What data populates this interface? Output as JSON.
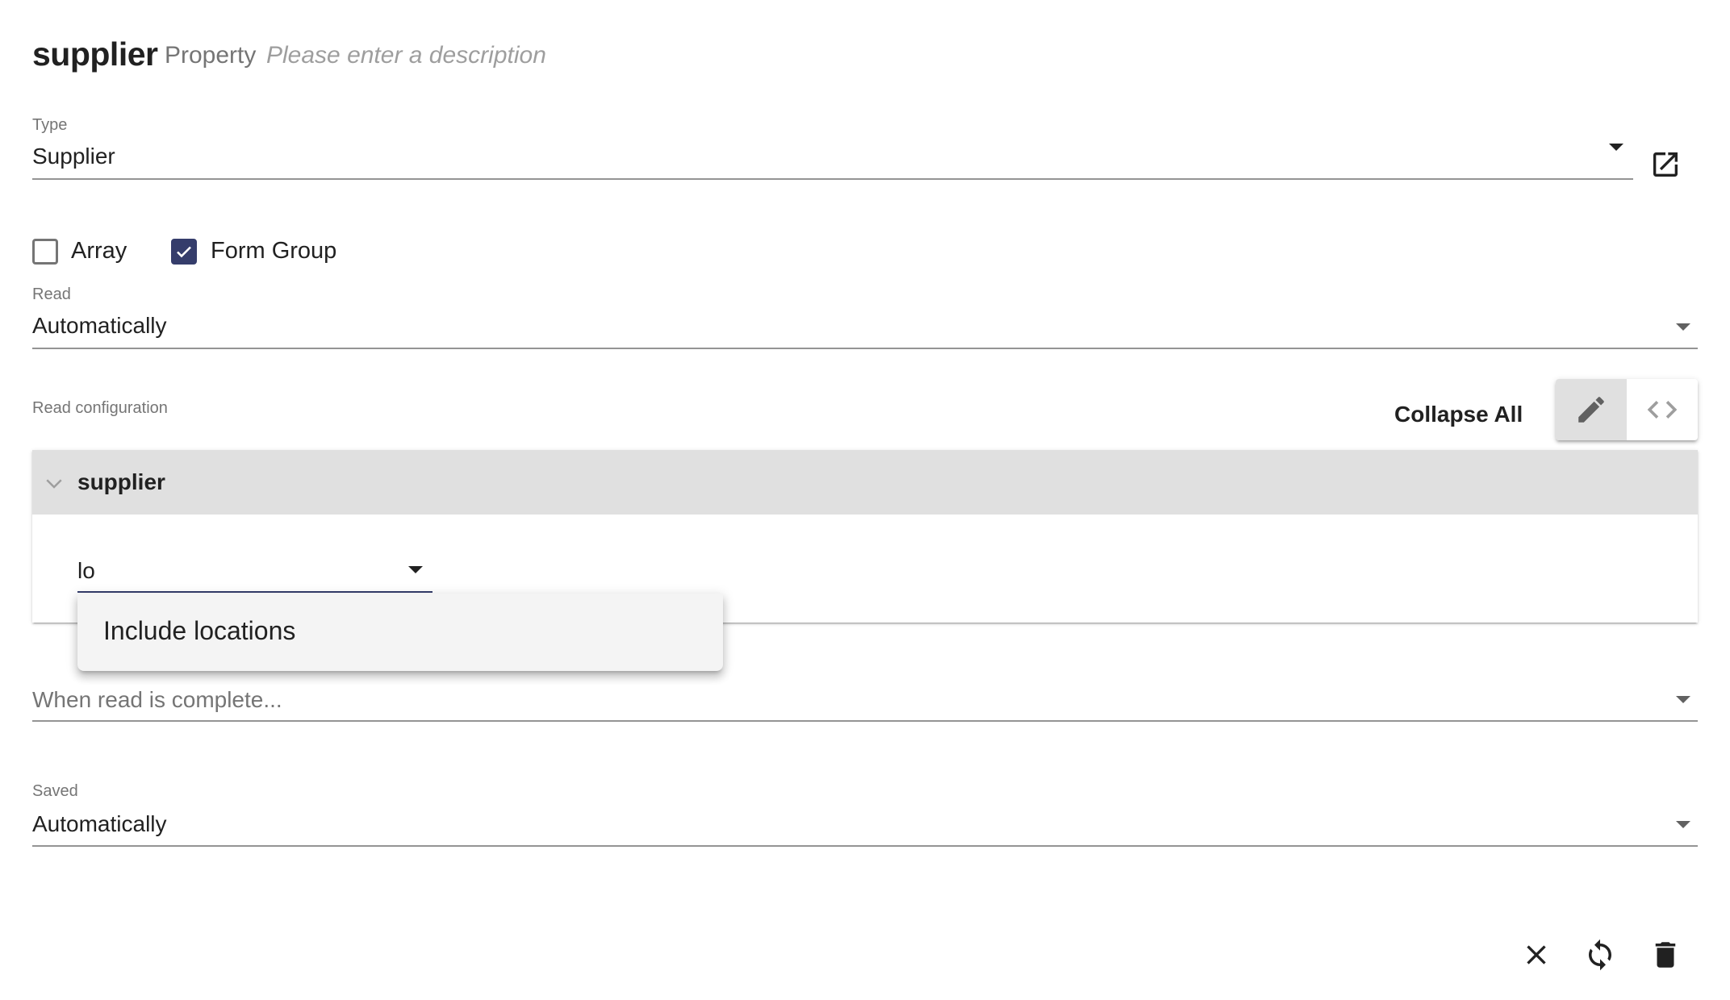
{
  "header": {
    "title": "supplier",
    "kind": "Property",
    "description_placeholder": "Please enter a description"
  },
  "type_field": {
    "label": "Type",
    "value": "Supplier",
    "open_icon": "open-in-new-icon"
  },
  "checkboxes": [
    {
      "label": "Array",
      "checked": false
    },
    {
      "label": "Form Group",
      "checked": true
    }
  ],
  "read_field": {
    "label": "Read",
    "value": "Automatically"
  },
  "read_configuration": {
    "label": "Read configuration",
    "collapse_all_label": "Collapse All",
    "view_toggle": [
      {
        "icon": "pencil-icon",
        "active": true
      },
      {
        "icon": "code-icon",
        "active": false
      }
    ],
    "panel": {
      "title": "supplier",
      "expanded": true,
      "input_value": "lo",
      "options": [
        "Include locations"
      ]
    }
  },
  "when_read_complete": {
    "placeholder": "When read is complete..."
  },
  "saved_field": {
    "label": "Saved",
    "value": "Automatically"
  },
  "footer_actions": [
    {
      "icon": "close-icon"
    },
    {
      "icon": "refresh-icon"
    },
    {
      "icon": "delete-icon"
    }
  ],
  "colors": {
    "accent": "#353d6b",
    "panel_header": "#e0e0e0",
    "dropdown_bg": "#f4f4f4"
  }
}
